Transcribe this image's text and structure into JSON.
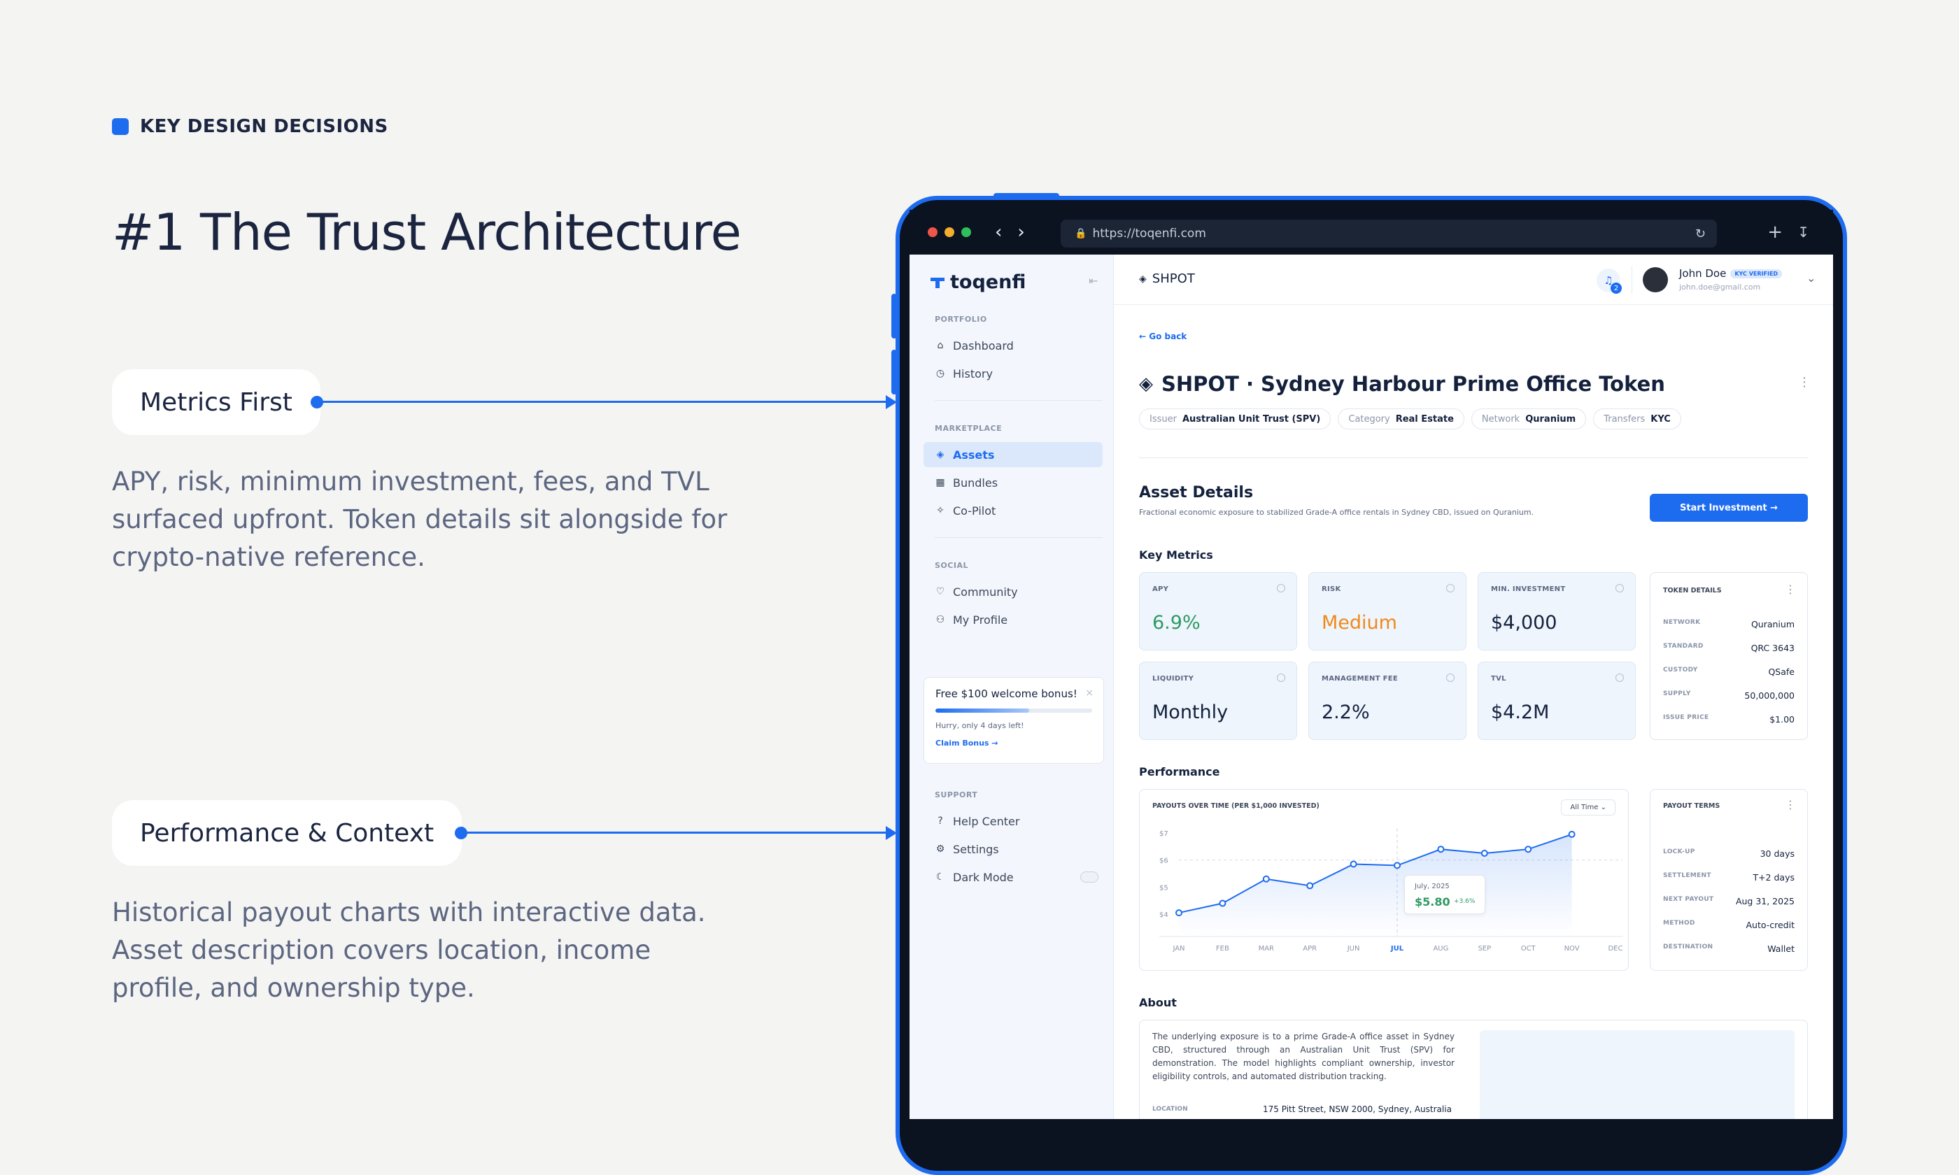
{
  "intro": {
    "section_label": "KEY DESIGN DECISIONS",
    "headline": "#1 The Trust Architecture",
    "callouts": [
      {
        "title": "Metrics First",
        "body": "APY, risk, minimum investment, fees, and TVL surfaced upfront. Token details sit alongside for crypto-native reference."
      },
      {
        "title": "Performance & Context",
        "body": "Historical payout charts with interactive data. Asset description covers location, income profile, and ownership type."
      }
    ]
  },
  "browser": {
    "url": "https://toqenfi.com"
  },
  "sidebar": {
    "logo": "toqenfi",
    "portfolio_label": "PORTFOLIO",
    "portfolio_items": [
      "Dashboard",
      "History"
    ],
    "marketplace_label": "MARKETPLACE",
    "marketplace_items": [
      "Assets",
      "Bundles",
      "Co-Pilot"
    ],
    "social_label": "SOCIAL",
    "social_items": [
      "Community",
      "My Profile"
    ],
    "bonus": {
      "title": "Free $100 welcome bonus!",
      "sub": "Hurry, only 4 days left!",
      "cta": "Claim Bonus →",
      "progress": 0.6
    },
    "support_label": "SUPPORT",
    "support_items": [
      "Help Center",
      "Settings",
      "Dark Mode"
    ]
  },
  "topbar": {
    "crumb": "SHPOT",
    "notif_count": "2",
    "user_name": "John Doe",
    "kyc_badge": "KYC VERIFIED",
    "user_email": "john.doe@gmail.com"
  },
  "asset": {
    "back": "← Go back",
    "title": "SHPOT · Sydney Harbour Prime Office Token",
    "chips": [
      {
        "k": "Issuer",
        "v": "Australian Unit Trust (SPV)"
      },
      {
        "k": "Category",
        "v": "Real Estate"
      },
      {
        "k": "Network",
        "v": "Quranium"
      },
      {
        "k": "Transfers",
        "v": "KYC"
      }
    ],
    "details_title": "Asset Details",
    "details_desc": "Fractional economic exposure to stabilized Grade-A office rentals in Sydney CBD, issued on Quranium.",
    "cta": "Start Investment →"
  },
  "metrics": {
    "title": "Key Metrics",
    "items": [
      {
        "label": "APY",
        "value": "6.9%",
        "color": "#2f9a63"
      },
      {
        "label": "RISK",
        "value": "Medium",
        "color": "#f0891a"
      },
      {
        "label": "MIN. INVESTMENT",
        "value": "$4,000",
        "color": "#14213d"
      },
      {
        "label": "LIQUIDITY",
        "value": "Monthly",
        "color": "#14213d"
      },
      {
        "label": "MANAGEMENT FEE",
        "value": "2.2%",
        "color": "#14213d"
      },
      {
        "label": "TVL",
        "value": "$4.2M",
        "color": "#14213d"
      }
    ]
  },
  "token_details": {
    "title": "TOKEN DETAILS",
    "rows": [
      {
        "k": "NETWORK",
        "v": "Quranium"
      },
      {
        "k": "STANDARD",
        "v": "QRC 3643"
      },
      {
        "k": "CUSTODY",
        "v": "QSafe"
      },
      {
        "k": "SUPPLY",
        "v": "50,000,000"
      },
      {
        "k": "ISSUE PRICE",
        "v": "$1.00"
      }
    ]
  },
  "performance": {
    "title": "Performance",
    "chart_title": "PAYOUTS OVER TIME (PER $1,000 INVESTED)",
    "range": "All Time ⌄",
    "tooltip": {
      "date": "July, 2025",
      "value": "$5.80",
      "change": "+3.6%"
    }
  },
  "chart_data": {
    "type": "line",
    "categories": [
      "JAN",
      "FEB",
      "MAR",
      "APR",
      "JUN",
      "JUL",
      "AUG",
      "SEP",
      "OCT",
      "NOV",
      "DEC"
    ],
    "values": [
      4.05,
      4.4,
      5.3,
      5.05,
      5.85,
      5.8,
      6.4,
      6.25,
      6.4,
      6.95,
      null
    ],
    "yticks": [
      "$7",
      "$6",
      "$5",
      "$4"
    ],
    "ylim": [
      4,
      7
    ],
    "highlight_index": 5,
    "color": "#1d6cf0"
  },
  "payout_terms": {
    "title": "PAYOUT TERMS",
    "rows": [
      {
        "k": "LOCK-UP",
        "v": "30 days"
      },
      {
        "k": "SETTLEMENT",
        "v": "T+2 days"
      },
      {
        "k": "NEXT PAYOUT",
        "v": "Aug 31, 2025"
      },
      {
        "k": "METHOD",
        "v": "Auto-credit"
      },
      {
        "k": "DESTINATION",
        "v": "Wallet"
      }
    ]
  },
  "about": {
    "title": "About",
    "text": "The underlying exposure is to a prime Grade-A office asset in Sydney CBD, structured through an Australian Unit Trust (SPV) for demonstration. The model highlights compliant ownership, investor eligibility controls, and automated distribution tracking.",
    "location_label": "LOCATION",
    "location_value": "175 Pitt Street, NSW 2000, Sydney, Australia"
  }
}
